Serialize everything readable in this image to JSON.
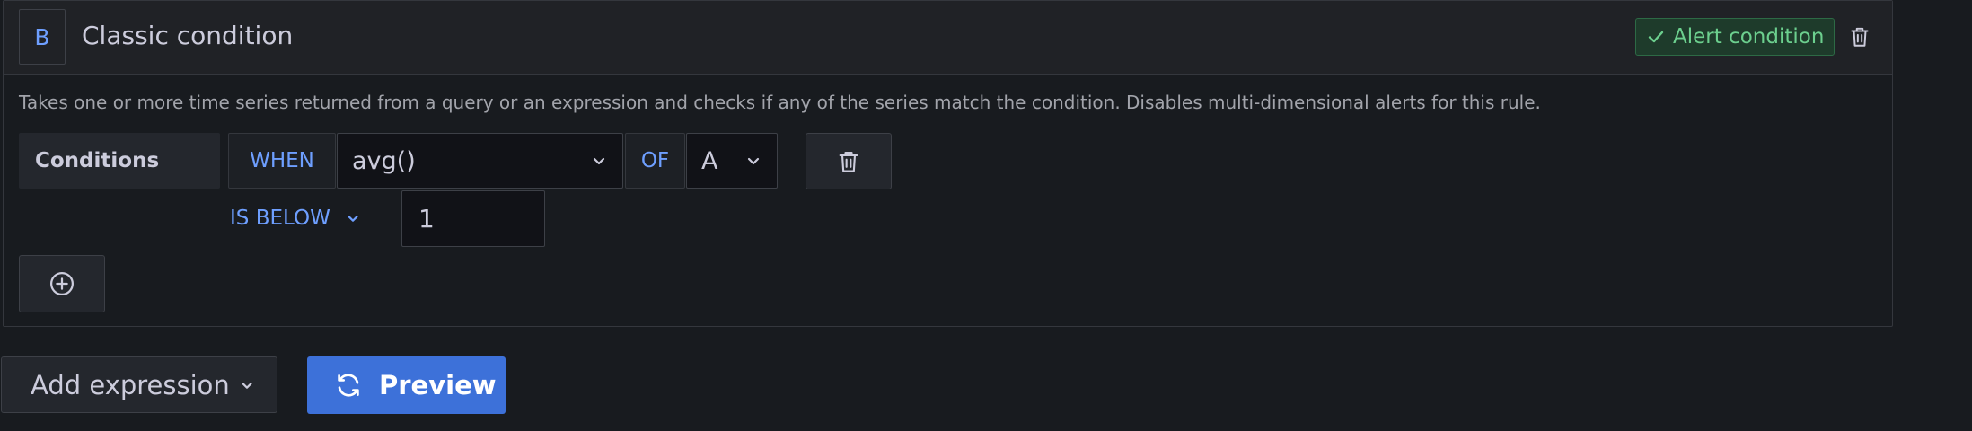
{
  "expression": {
    "ref_id": "B",
    "title": "Classic condition",
    "alert_badge": "Alert condition",
    "description": "Takes one or more time series returned from a query or an expression and checks if any of the series match the condition. Disables multi-dimensional alerts for this rule."
  },
  "conditions": {
    "label": "Conditions",
    "when_keyword": "WHEN",
    "reducer_value": "avg()",
    "of_keyword": "OF",
    "query_value": "A",
    "evaluator_value": "IS BELOW",
    "threshold_value": "1"
  },
  "footer": {
    "add_expression_label": "Add expression",
    "preview_label": "Preview"
  },
  "icons": {
    "header_delete": "trash-icon",
    "alert_check": "check-icon",
    "condition_delete": "trash-icon",
    "add_condition": "plus-circle-icon",
    "preview": "sync-icon"
  },
  "colors": {
    "accent_blue": "#6e9fff",
    "primary_button": "#3d71d9",
    "success_green": "#6ccf8e",
    "background": "#181b1f"
  }
}
